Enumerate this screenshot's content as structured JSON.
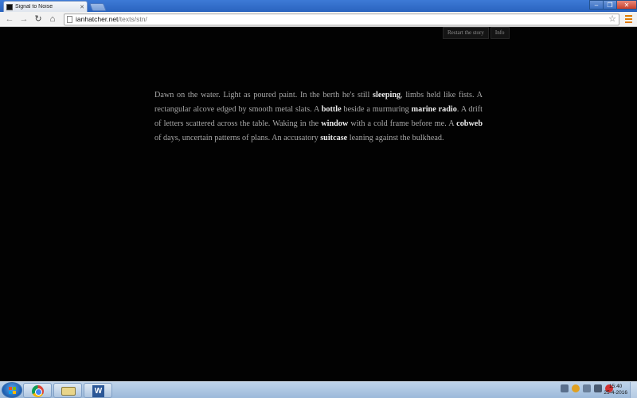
{
  "browser": {
    "tab_title": "Signal to Noise",
    "url_host": "ianhatcher.net",
    "url_path": "/texts/stn/"
  },
  "story_controls": {
    "restart_label": "Restart the story",
    "info_label": "Info"
  },
  "story": {
    "t1": "Dawn on the water. Light as poured paint. In the berth he's still ",
    "k1": "sleeping",
    "t2": ", limbs held like fists. A rectangular alcove edged by smooth metal slats. A ",
    "k2": "bottle",
    "t3": " beside a murmuring ",
    "k3": "marine radio",
    "t4": ". A drift of letters scattered across the table. Waking in the ",
    "k4": "window",
    "t5": " with a cold frame before me. A ",
    "k5": "cobweb",
    "t6": " of days, uncertain patterns of plans. An accusatory ",
    "k6": "suitcase",
    "t7": " leaning against the bulkhead."
  },
  "taskbar": {
    "time": "15:40",
    "date": "25-4-2016",
    "word_label": "W"
  },
  "colors": {
    "page_background": "#020202",
    "text": "#a9a9a9",
    "keyword": "#ececec"
  }
}
